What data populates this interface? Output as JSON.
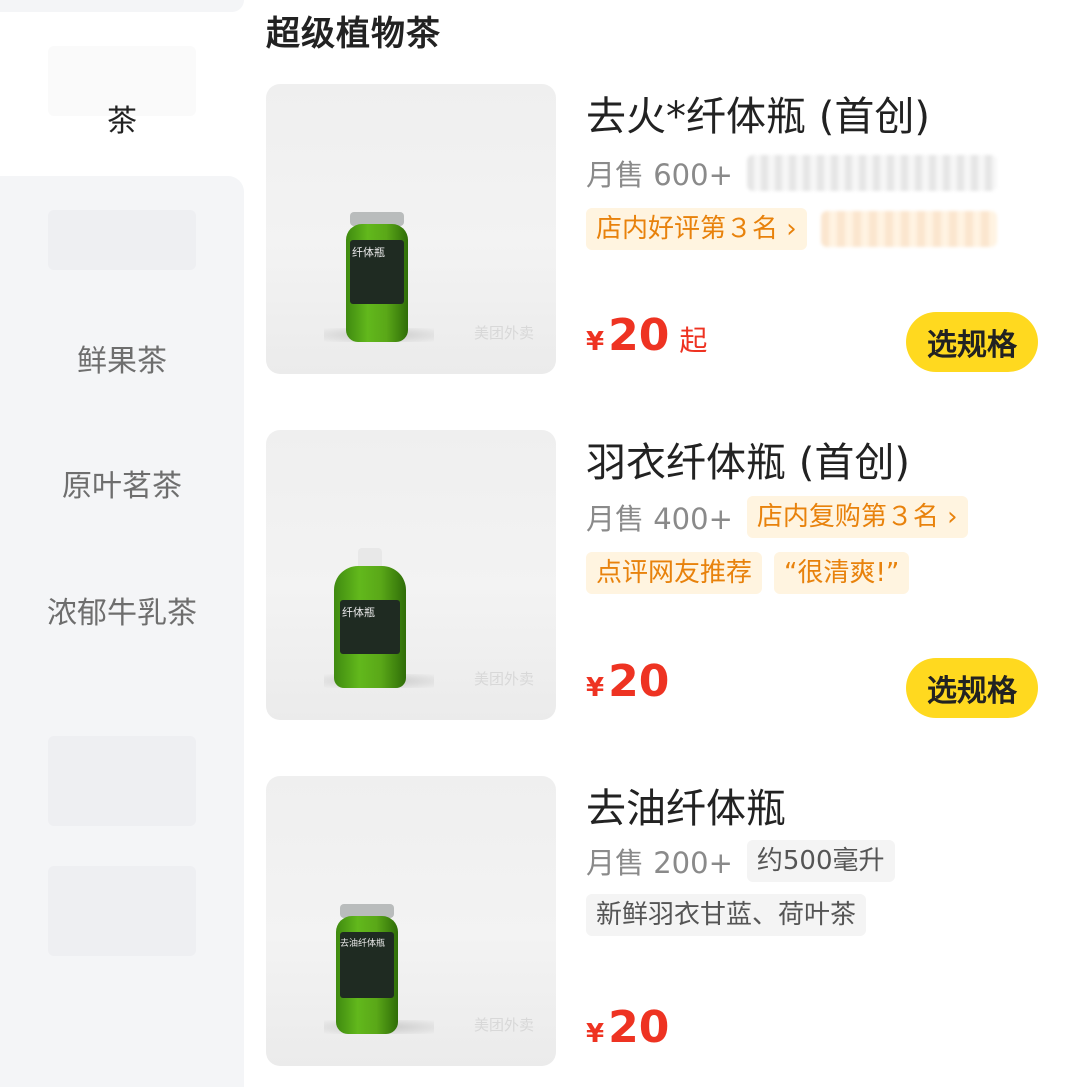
{
  "sidebar": {
    "active_category": "茶",
    "categories": [
      {
        "label": "鲜果茶"
      },
      {
        "label": "原叶茗茶"
      },
      {
        "label": "浓郁牛乳茶"
      }
    ]
  },
  "section": {
    "title": "超级植物茶"
  },
  "products": [
    {
      "name": "去火*纤体瓶 (首创)",
      "sales": "月售 600+",
      "tags": [
        {
          "text": "店内好评第３名",
          "chevron": "chevron-right-icon"
        }
      ],
      "price_symbol": "¥",
      "price": "20",
      "price_suffix": "起",
      "action": "选规格",
      "bottle_label": "纤体瓶"
    },
    {
      "name": "羽衣纤体瓶 (首创)",
      "sales": "月售 400+",
      "tags": [
        {
          "text": "店内复购第３名",
          "chevron": "chevron-right-icon"
        },
        {
          "text": "点评网友推荐"
        },
        {
          "text": "“很清爽!”"
        }
      ],
      "price_symbol": "¥",
      "price": "20",
      "action": "选规格",
      "bottle_label": "纤体瓶"
    },
    {
      "name": "去油纤体瓶",
      "sales": "月售 200+",
      "tags": [
        {
          "text": "约500毫升"
        },
        {
          "text": "新鲜羽衣甘蓝、荷叶茶"
        }
      ],
      "price_symbol": "¥",
      "price": "20",
      "bottle_label": "去油纤体瓶"
    }
  ],
  "watermark": "美团外卖",
  "colors": {
    "price": "#ee3322",
    "action_button": "#ffd91f",
    "tag_orange_bg": "#fff4e0",
    "tag_orange_text": "#e8820c",
    "sidebar_bg": "#f4f5f7"
  }
}
